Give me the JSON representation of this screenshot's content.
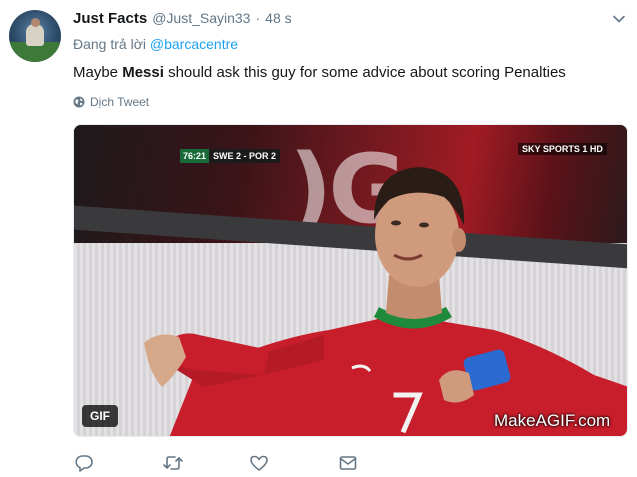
{
  "tweet": {
    "display_name": "Just Facts",
    "handle": "@Just_Sayin33",
    "separator": "·",
    "time": "48 s",
    "reply_prefix": "Đang trả lời",
    "reply_to": "@barcacentre",
    "text_before": "Maybe ",
    "text_bold": "Messi",
    "text_after": " should ask this guy for some advice about scoring Penalties",
    "translate_label": "Dịch Tweet"
  },
  "media": {
    "gif_badge": "GIF",
    "watermark": "MakeAGIF.com",
    "scorebug_time": "76:21",
    "scorebug_score": "SWE 2 - POR 2",
    "channel_logo": "SKY SPORTS 1 HD"
  },
  "actions": {
    "icons": [
      "reply-icon",
      "retweet-icon",
      "like-icon",
      "message-icon"
    ]
  },
  "colors": {
    "link": "#1da1f2",
    "muted": "#657786",
    "text": "#14171a",
    "jersey_red": "#c81e2b"
  }
}
